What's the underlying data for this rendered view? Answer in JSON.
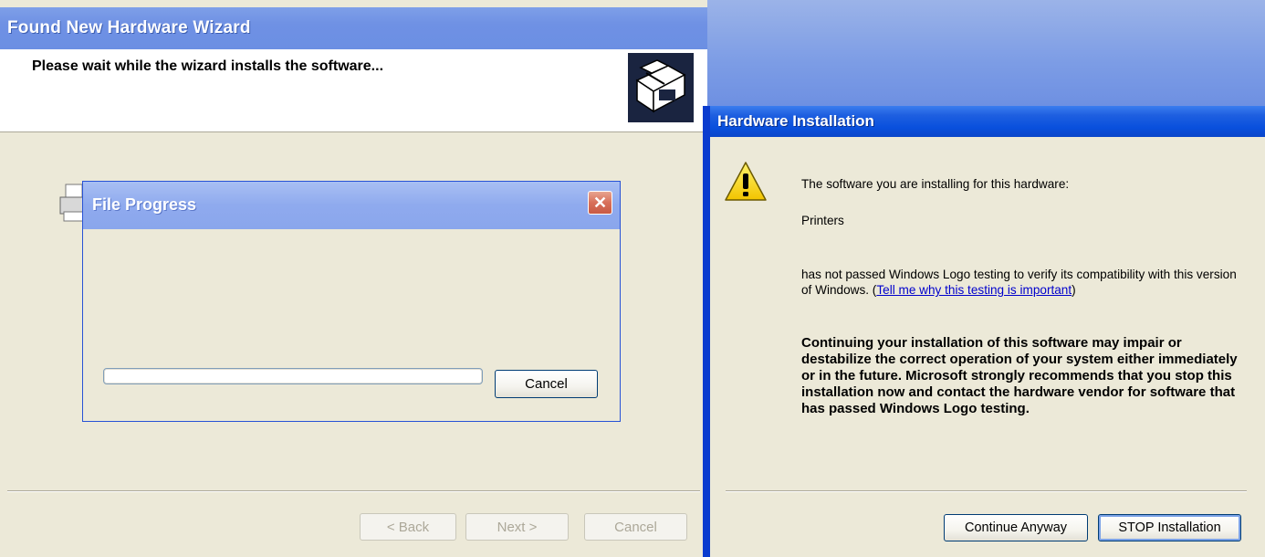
{
  "wizard": {
    "title": "Found New Hardware Wizard",
    "header_text": "Please wait while the wizard installs the software...",
    "icons": {
      "hardware": "hardware-box-icon",
      "printer": "printer-icon"
    },
    "buttons": {
      "back": "< Back",
      "next": "Next >",
      "cancel": "Cancel"
    }
  },
  "file_progress": {
    "title": "File Progress",
    "close_glyph": "✕",
    "progress": 0,
    "cancel_label": "Cancel"
  },
  "hardware_installation": {
    "title": "Hardware Installation",
    "icon": "warning-icon",
    "line1": "The software you are installing for this hardware:",
    "device": "Printers",
    "line2_prefix": "has not passed Windows Logo testing to verify its compatibility with this version of Windows. (",
    "link": "Tell me why this testing is important",
    "line2_suffix": ")",
    "warning": "Continuing your installation of this software may impair or destabilize the correct operation of your system either immediately or in the future. Microsoft strongly recommends that you stop this installation now and contact the hardware vendor for software that has passed Windows Logo testing.",
    "continue_label": "Continue Anyway",
    "stop_label": "STOP Installation"
  },
  "colors": {
    "xp_face": "#ECE9D8",
    "title_blue": "#0A46C9",
    "link": "#0000CC"
  }
}
